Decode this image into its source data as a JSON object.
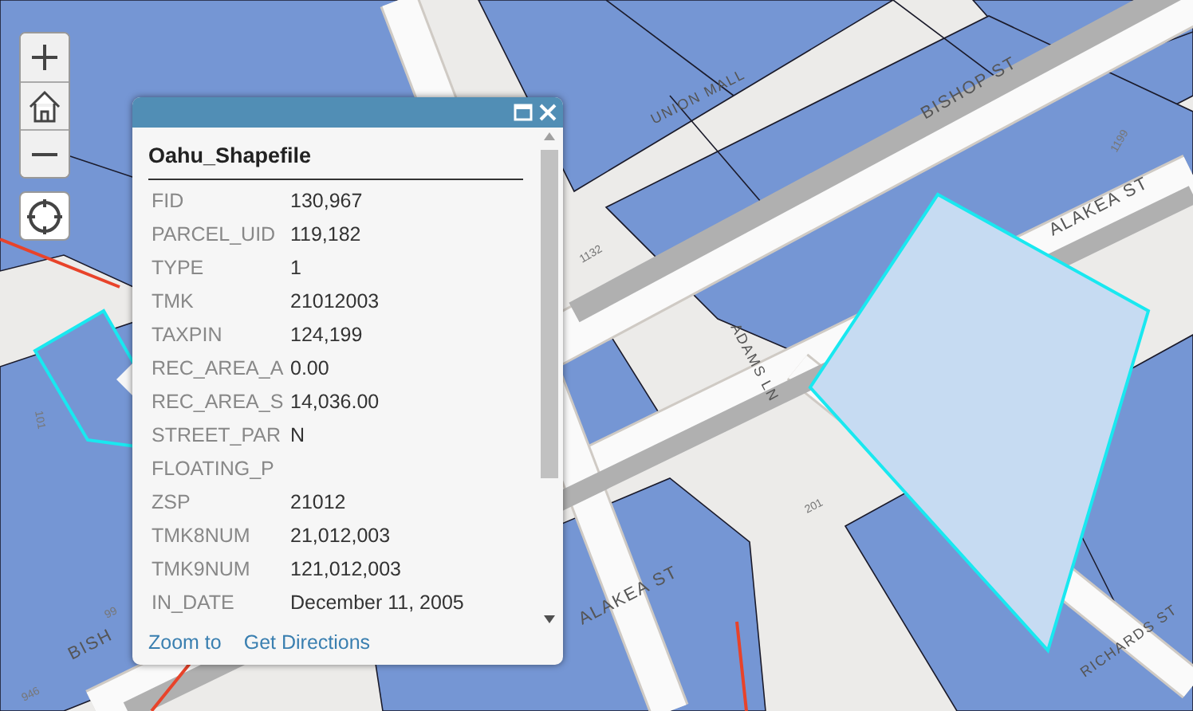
{
  "map": {
    "labels": [
      {
        "text": "BISHOP ST",
        "kind": "street"
      },
      {
        "text": "ALAKEA ST",
        "kind": "street"
      },
      {
        "text": "ALAKEA ST",
        "kind": "street"
      },
      {
        "text": "UNION MALL",
        "kind": "street"
      },
      {
        "text": "ADAMS LN",
        "kind": "street"
      },
      {
        "text": "RICHARDS ST",
        "kind": "street"
      },
      {
        "text": "BISH",
        "kind": "street"
      },
      {
        "text": "1132",
        "kind": "number"
      },
      {
        "text": "1199",
        "kind": "number"
      },
      {
        "text": "101",
        "kind": "number"
      },
      {
        "text": "201",
        "kind": "number"
      },
      {
        "text": "946",
        "kind": "number"
      },
      {
        "text": "99",
        "kind": "number"
      }
    ]
  },
  "popup": {
    "title": "Oahu_Shapefile",
    "fields": [
      {
        "label": "FID",
        "value": "130,967"
      },
      {
        "label": "PARCEL_UID",
        "value": "119,182"
      },
      {
        "label": "TYPE",
        "value": "1"
      },
      {
        "label": "TMK",
        "value": "21012003"
      },
      {
        "label": "TAXPIN",
        "value": "124,199"
      },
      {
        "label": "REC_AREA_A",
        "value": "0.00"
      },
      {
        "label": "REC_AREA_S",
        "value": "14,036.00"
      },
      {
        "label": "STREET_PAR",
        "value": "N"
      },
      {
        "label": "FLOATING_P"
      },
      {
        "label": "ZSP",
        "value": "21012"
      },
      {
        "label": "TMK8NUM",
        "value": "21,012,003"
      },
      {
        "label": "TMK9NUM",
        "value": "121,012,003"
      },
      {
        "label": "IN_DATE",
        "value": "December 11, 2005"
      }
    ],
    "actions": [
      "Zoom to",
      "Get Directions"
    ]
  }
}
